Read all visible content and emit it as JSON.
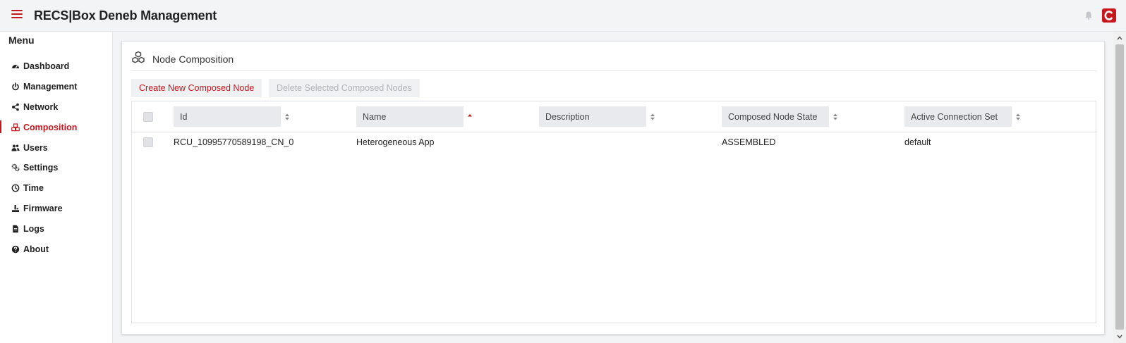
{
  "app": {
    "title": "RECS|Box Deneb Management"
  },
  "colors": {
    "accent": "#c8161d",
    "background": "#f3f4f6"
  },
  "sidebar": {
    "heading": "Menu",
    "items": [
      {
        "label": "Dashboard",
        "icon": "dashboard-icon",
        "active": false
      },
      {
        "label": "Management",
        "icon": "power-icon",
        "active": false
      },
      {
        "label": "Network",
        "icon": "share-icon",
        "active": false
      },
      {
        "label": "Composition",
        "icon": "cubes-icon",
        "active": true
      },
      {
        "label": "Users",
        "icon": "users-icon",
        "active": false
      },
      {
        "label": "Settings",
        "icon": "cogs-icon",
        "active": false
      },
      {
        "label": "Time",
        "icon": "clock-icon",
        "active": false
      },
      {
        "label": "Firmware",
        "icon": "firmware-icon",
        "active": false
      },
      {
        "label": "Logs",
        "icon": "document-icon",
        "active": false
      },
      {
        "label": "About",
        "icon": "question-icon",
        "active": false
      }
    ]
  },
  "panel": {
    "title": "Node Composition",
    "create_label": "Create New Composed Node",
    "delete_label": "Delete Selected Composed Nodes"
  },
  "table": {
    "columns": [
      {
        "label": "Id",
        "sort": "none"
      },
      {
        "label": "Name",
        "sort": "ascending"
      },
      {
        "label": "Description",
        "sort": "none"
      },
      {
        "label": "Composed Node State",
        "sort": "none"
      },
      {
        "label": "Active Connection Set",
        "sort": "none"
      }
    ],
    "rows": [
      {
        "id": "RCU_10995770589198_CN_0",
        "name": "Heterogeneous App",
        "description": "",
        "state": "ASSEMBLED",
        "connection_set": "default"
      }
    ]
  }
}
